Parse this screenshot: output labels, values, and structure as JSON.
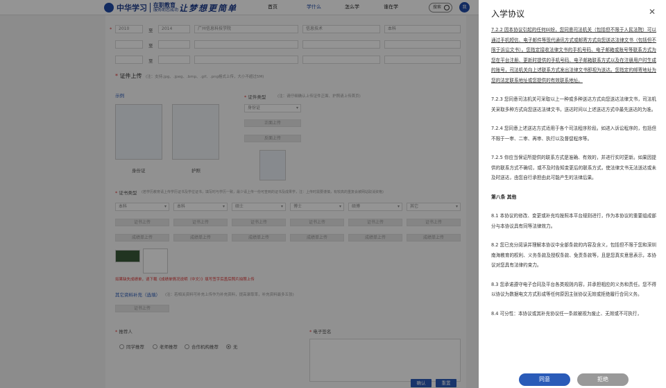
{
  "header": {
    "logo_cn": "中华学习",
    "logo_sub_title": "在职教育",
    "logo_sub_line": "服务助您成功",
    "slogan": "让梦想更简单",
    "nav": [
      "首页",
      "学什么",
      "怎么学",
      "谁在学"
    ],
    "search_label": "搜索",
    "avatar_text": "我"
  },
  "form": {
    "row1": {
      "start": "2010",
      "sep": "至",
      "end": "2014",
      "school": "广州信息科技学院",
      "major": "信息技术",
      "level": "本科"
    },
    "sep": "至",
    "cert_upload_title": "证件上传",
    "cert_upload_hint": "(注：支持.jpg、.jpeg、.bmp、.gif、.png格式上传，大小不超过5M)",
    "example_label": "示例",
    "idcard_label": "身份证",
    "passport_label": "护照",
    "cert_type_label": "证件类型",
    "cert_type_hint": "(注：请仔细确认上传证件正面、护照请上传首页)",
    "cert_type_value": "身份证",
    "front_upload": "正面上传",
    "back_upload": "反面上传",
    "diploma_type_label": "证书类型",
    "diploma_type_hint": "(若学历教育请上传学历证书及学位证书，填写时与学历一致，最少请上传一份可查到的证书及成果学，注：上传时需要谨慎，有较高的重复会被网站取消资格)",
    "diploma_selects": [
      "本科",
      "本科",
      "硕士",
      "博士",
      "硕博",
      "其它"
    ],
    "cert_upload_btn": "证书上传",
    "transcript_upload_btn": "成绩单上传",
    "transcript_link_note": "如果缺失成绩单，请下载《成绩单情况说明（中文）》填写签字后盖后照片拍照上传",
    "other_label": "其它资料补充（选填）",
    "other_hint": "(注：若相关资料可补充上传作为补充资料，提高录取率，补充资料最多五张)",
    "other_upload_btn": "证书上传",
    "referrer_label": "推荐人",
    "signature_label": "电子签名",
    "referrer_options": [
      "同学推荐",
      "老师推荐",
      "合作机构推荐",
      "无"
    ],
    "referrer_selected": 3,
    "confirm_btn": "确认",
    "reset_btn": "重置"
  },
  "drawer": {
    "title": "入学协议",
    "sections": [
      {
        "type": "p",
        "underline": true,
        "text": "7.2.2 因本协议引起的任何纠纷，您同意司法机关（包括但不限于人民法院）可以通过手机短信、电子邮件等现代通讯方式或邮寄方式向您送达法律文书（包括但不限于诉讼文书）。您指定接收法律文书的手机号码、电子邮箱或账号等联系方式为您在平台注册、更新时提供的手机号码、电子邮箱联系方式以及在注册用户时生成的账号，司法机关向上述联系方式发出法律文书即视为送达。您指定的邮寄地址为您的法定联系地址或您提供的有效联系地址。"
      },
      {
        "type": "p",
        "text": "7.2.3 您同意司法机关可采取以上一种或多种送达方式向您送达法律文书，司法机关采取多种方式向您送达法律文书，送达时间以上述送达方式中最先送达的为准。"
      },
      {
        "type": "p",
        "text": "7.2.4 您同意上述送达方式适用于各个司法程序阶段。如进入诉讼程序的，包括但不限于一审、二审、再审、执行以及督促程序等。"
      },
      {
        "type": "p",
        "text": "7.2.5 你应当保证所提供的联系方式是准确、有效的，并进行实时更新。如果因提供的联系方式不确切，或不及时告知变更后的联系方式，使法律文书无法送达或未及时送达，由您自行承担由此可能产生的法律后果。"
      },
      {
        "type": "h",
        "text": "第八条 其他"
      },
      {
        "type": "p",
        "text": "8.1 本协议的修改、变更或补充均按照本平台规则进行，作为本协议的重要组成部分与本协议具有同等法律效力。"
      },
      {
        "type": "p",
        "text": "8.2 您已充分阅读并理解本协议中全部条款的内容及含义，包括但不限于您和深圳南海教育的权利、义务条款及授权条款、免责条款等，且是您真实意思表示，本协议对您具有法律约束力。"
      },
      {
        "type": "p",
        "text": "8.3 您承诺遵守电子合同及平台各类规则内容，并承担相应的义务和责任。您不得以协议为数据电文方式形成等任何原因主张协议无效或拒绝履行合同义务。"
      },
      {
        "type": "p",
        "text": "8.4 可分性：本协议或其补充协议任一条款被视为废止、无效或不可执行，"
      }
    ],
    "agree_btn": "同意",
    "reject_btn": "拒绝"
  }
}
